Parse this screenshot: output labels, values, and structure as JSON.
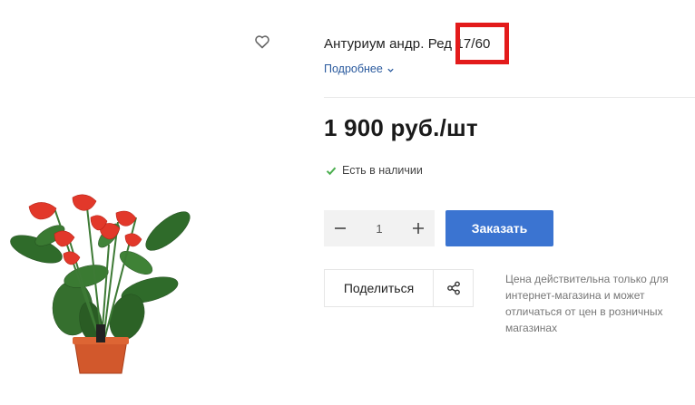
{
  "product": {
    "title": "Антуриум андр. Ред 17/60",
    "details_link": "Подробнее",
    "price": "1 900 руб./шт",
    "stock_status": "Есть в наличии",
    "image_alt": "anthurium-plant"
  },
  "quantity": {
    "value": "1"
  },
  "actions": {
    "order_label": "Заказать",
    "share_label": "Поделиться"
  },
  "note": "Цена действительна только для интернет-магазина и может отличаться от цен в розничных магазинах",
  "icons": {
    "wishlist": "heart-icon",
    "details": "chevron-down-icon",
    "stock": "check-icon",
    "minus": "minus-icon",
    "plus": "plus-icon",
    "share": "share-icon"
  },
  "colors": {
    "accent": "#3b74d1",
    "link": "#2a5a9e",
    "highlight": "#e31b1b",
    "in_stock": "#4caf50"
  }
}
